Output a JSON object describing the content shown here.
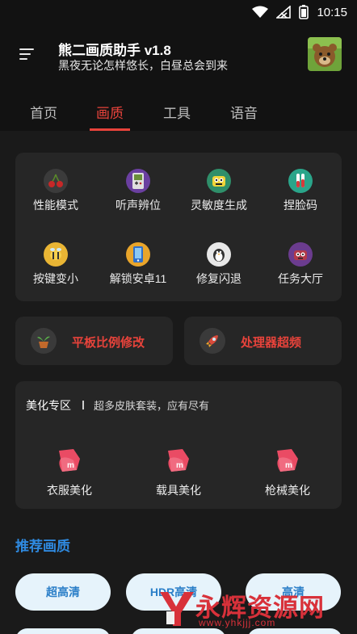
{
  "status_bar": {
    "time": "10:15"
  },
  "header": {
    "title": "熊二画质助手 v1.8",
    "subtitle": "黑夜无论怎样悠长，白昼总会到来"
  },
  "tabs": [
    {
      "label": "首页"
    },
    {
      "label": "画质"
    },
    {
      "label": "工具"
    },
    {
      "label": "语音"
    }
  ],
  "active_tab": "画质",
  "tools": [
    {
      "label": "性能模式",
      "icon": "cherry-icon"
    },
    {
      "label": "听声辨位",
      "icon": "gameboy-icon"
    },
    {
      "label": "灵敏度生成",
      "icon": "monster-icon"
    },
    {
      "label": "捏脸码",
      "icon": "test-tube-icon"
    },
    {
      "label": "按键变小",
      "icon": "bee-icon"
    },
    {
      "label": "解锁安卓11",
      "icon": "phone-icon"
    },
    {
      "label": "修复闪退",
      "icon": "penguin-icon"
    },
    {
      "label": "任务大厅",
      "icon": "purple-monster-icon"
    }
  ],
  "wide_buttons": [
    {
      "label": "平板比例修改",
      "icon": "plant-icon"
    },
    {
      "label": "处理器超频",
      "icon": "rocket-icon"
    }
  ],
  "beauty": {
    "title": "美化专区",
    "subtitle": "超多皮肤套装，应有尽有",
    "items": [
      {
        "label": "衣服美化",
        "icon": "m-tag-icon"
      },
      {
        "label": "载具美化",
        "icon": "m-tag-icon"
      },
      {
        "label": "枪械美化",
        "icon": "m-tag-icon"
      }
    ]
  },
  "recommend": {
    "title": "推荐画质",
    "options": [
      {
        "label": "超高清"
      },
      {
        "label": "HDR高清"
      },
      {
        "label": "高清"
      }
    ]
  },
  "watermark": {
    "text": "永辉资源网",
    "url": "www.yhkjjj.com"
  },
  "colors": {
    "accent_red": "#e8433b",
    "accent_blue": "#2f8ae0",
    "card_bg": "#262626",
    "page_bg": "#1a1a1a"
  }
}
